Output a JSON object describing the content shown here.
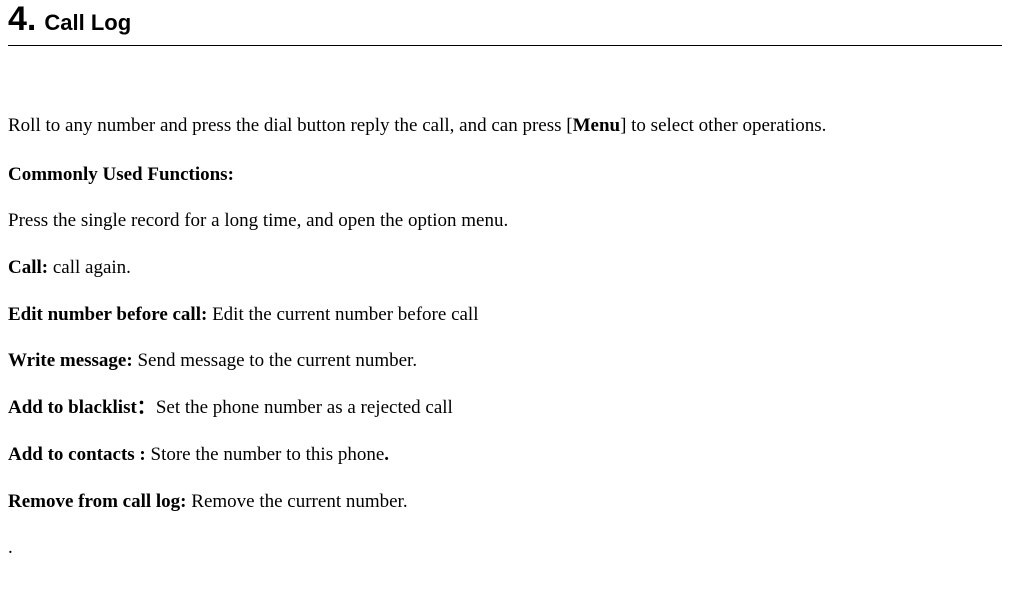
{
  "section": {
    "number": "4.",
    "title": "Call Log"
  },
  "intro": {
    "prefix": "Roll to any number and press the dial button reply the call, and can press [",
    "menu_word": "Menu",
    "suffix": "] to select other operations."
  },
  "commonly_used_heading": "Commonly Used Functions:",
  "longpress_text": "Press the single record for a long time, and open the option menu.",
  "functions": [
    {
      "label": "Call:",
      "desc": " call again."
    },
    {
      "label": "Edit number before call:",
      "desc": " Edit the current number before call"
    },
    {
      "label": "Write    message:",
      "desc": " Send message to the current number."
    },
    {
      "label": "Add to blacklist：",
      "desc": "Set the phone number as a rejected call"
    },
    {
      "label": "Add to contacts :",
      "desc": " Store the number to this phone",
      "trailing_bold": "."
    },
    {
      "label": "Remove from call log:",
      "desc": " Remove the current number."
    }
  ],
  "trailing_dot": "."
}
